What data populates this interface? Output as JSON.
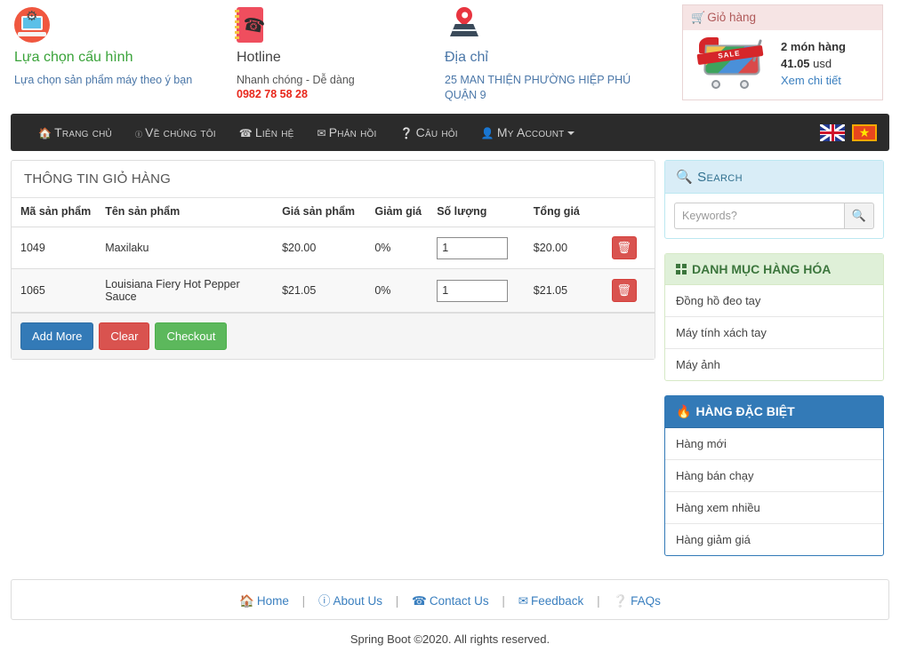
{
  "header": {
    "features": [
      {
        "icon": "config-laptop-gear-icon",
        "title": "Lựa chọn cấu hình",
        "sub": "Lựa chọn sản phẩm máy theo ý bạn"
      },
      {
        "icon": "phonebook-icon",
        "title": "Hotline",
        "sub": "Nhanh chóng - Dễ dàng",
        "phone": "0982 78 58 28"
      },
      {
        "icon": "map-pin-icon",
        "title": "Địa chỉ",
        "sub_line1": "25 MAN THIỆN PHƯỜNG HIỆP PHÚ",
        "sub_line2": "QUẬN 9"
      }
    ],
    "cart_widget": {
      "title": "Giỏ hàng",
      "items_text": "2 món hàng",
      "items_count": "2",
      "total_text": "41.05 usd",
      "total_value": "41.05",
      "currency": "usd",
      "detail_link": "Xem chi tiết"
    }
  },
  "nav": {
    "items": [
      {
        "label": "Trang chủ",
        "icon": "home-icon"
      },
      {
        "label": "Về chúng tôi",
        "icon": "info-icon"
      },
      {
        "label": "Liên hệ",
        "icon": "phone-icon"
      },
      {
        "label": "Phản hồi",
        "icon": "envelope-icon"
      },
      {
        "label": "Câu hỏi",
        "icon": "question-icon"
      },
      {
        "label": "My Account",
        "icon": "user-icon",
        "has_caret": true
      }
    ],
    "flags": [
      {
        "name": "flag-uk",
        "label": "English"
      },
      {
        "name": "flag-vn",
        "label": "Tiếng Việt"
      }
    ]
  },
  "cart_panel": {
    "title": "THÔNG TIN GIỎ HÀNG",
    "columns": [
      "Mã sản phẩm",
      "Tên sản phẩm",
      "Giá sản phẩm",
      "Giảm giá",
      "Số lượng",
      "Tổng giá"
    ],
    "rows": [
      {
        "code": "1049",
        "name": "Maxilaku",
        "price": "$20.00",
        "discount": "0%",
        "qty": "1",
        "total": "$20.00"
      },
      {
        "code": "1065",
        "name": "Louisiana Fiery Hot Pepper Sauce",
        "price": "$21.05",
        "discount": "0%",
        "qty": "1",
        "total": "$21.05"
      }
    ],
    "buttons": {
      "add_more": "Add More",
      "clear": "Clear",
      "checkout": "Checkout"
    }
  },
  "sidebar": {
    "search": {
      "title": "Search",
      "placeholder": "Keywords?",
      "value": ""
    },
    "categories": {
      "title": "DANH MỤC HÀNG HÓA",
      "items": [
        "Đồng hồ đeo tay",
        "Máy tính xách tay",
        "Máy ảnh"
      ]
    },
    "special": {
      "title": "HÀNG ĐẶC BIỆT",
      "items": [
        "Hàng mới",
        "Hàng bán chạy",
        "Hàng xem nhiều",
        "Hàng giảm giá"
      ]
    }
  },
  "footer": {
    "links": [
      {
        "label": "Home",
        "icon": "home-icon"
      },
      {
        "label": "About Us",
        "icon": "info-icon"
      },
      {
        "label": "Contact Us",
        "icon": "phone-icon"
      },
      {
        "label": "Feedback",
        "icon": "envelope-icon"
      },
      {
        "label": "FAQs",
        "icon": "question-icon"
      }
    ],
    "separator": "|",
    "copyright": "Spring Boot ©2020. All rights reserved."
  },
  "colors": {
    "nav_bg": "#2b2b2b",
    "primary": "#337ab7",
    "danger": "#d9534f",
    "success": "#5cb85c",
    "link": "#3a7fbf",
    "phone_red": "#e8271b",
    "green_title": "#3aa33a"
  }
}
